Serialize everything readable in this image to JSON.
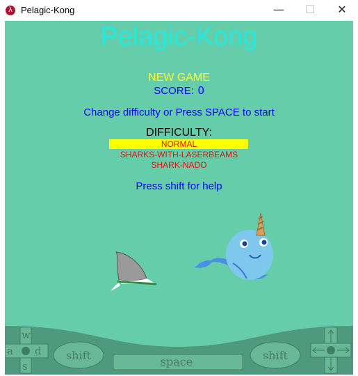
{
  "window": {
    "title": "Pelagic-Kong",
    "app_icon": "λ",
    "minimize_glyph": "—",
    "maximize_glyph": "☐",
    "close_glyph": "✕"
  },
  "game": {
    "title": "Pelagic-Kong",
    "status": "NEW GAME",
    "score_label": "SCORE:",
    "score_value": "0",
    "instructions": "Change difficulty or Press SPACE to start",
    "difficulty_label": "DIFFICULTY:",
    "difficulty_options": [
      "NORMAL",
      "SHARKS-WITH-LASERBEAMS",
      "SHARK-NADO"
    ],
    "selected_difficulty": "NORMAL",
    "help_text": "Press shift for help"
  },
  "controls": {
    "wasd": [
      "w",
      "a",
      "s",
      "d"
    ],
    "left_shift": "shift",
    "space": "space",
    "right_shift": "shift",
    "arrows_icon": "arrow-keys-icon"
  },
  "colors": {
    "background": "#66cdaa",
    "title": "#1fe9e0",
    "status": "#ffff33",
    "text": "#0000ff",
    "highlight": "#ffff00",
    "option": "#e81010",
    "controls_panel": "#4f9a7e"
  }
}
